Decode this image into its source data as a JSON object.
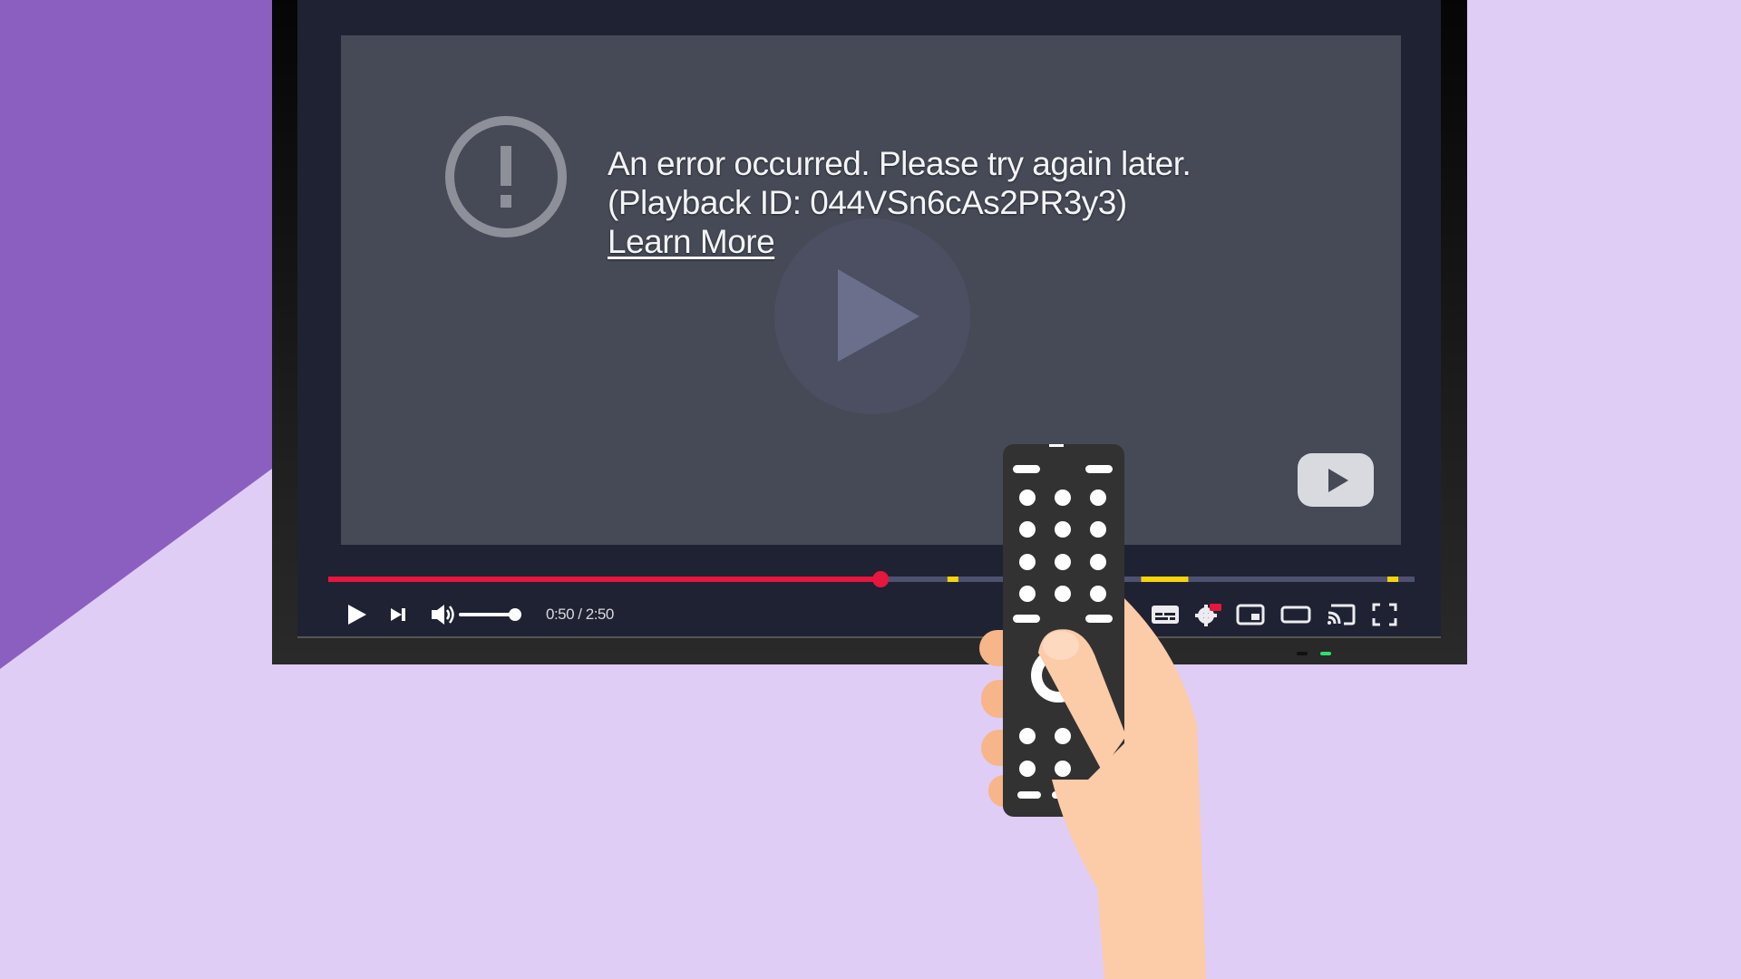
{
  "player": {
    "error": {
      "message": "An error occurred. Please try again later.",
      "playback_id_line": "(Playback ID: 044VSn6cAs2PR3y3)",
      "learn_more_label": "Learn More",
      "icon": "exclamation-circle-icon"
    },
    "big_play_icon": "play-icon",
    "logo_icon": "youtube-logo-icon",
    "progress": {
      "played_fraction": 0.5085,
      "played_color": "#e6163f",
      "remaining_color": "#4e5270",
      "ad_markers_fractions": [
        0.575,
        0.77,
        0.98
      ],
      "ad_marker_color": "#f6d40c"
    },
    "controls": {
      "play_icon": "play-icon",
      "next_icon": "skip-next-icon",
      "volume_icon": "volume-icon",
      "volume_level": 1.0,
      "time_display": "0:50 / 2:50",
      "right_icons": [
        "subtitles-icon",
        "settings-icon",
        "miniplayer-icon",
        "theater-mode-icon",
        "cast-icon",
        "fullscreen-icon"
      ],
      "settings_badge": "HD"
    }
  },
  "scene": {
    "background_light": "#dfcdf6",
    "background_dark": "#8b5fc0",
    "remote_color": "#323232",
    "skin_color": "#fccba8",
    "led_colors": [
      "#111111",
      "#2ee06b"
    ]
  }
}
